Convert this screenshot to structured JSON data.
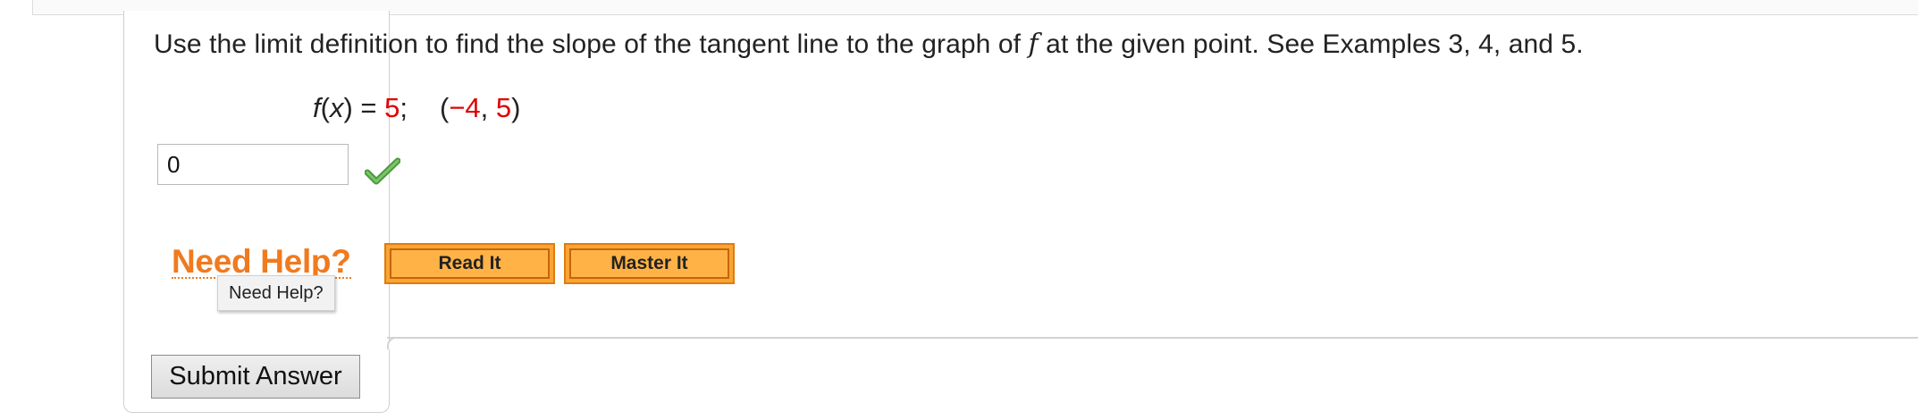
{
  "question": {
    "prefix": "Use the limit definition to find the slope of the tangent line to the graph of ",
    "func_name": "f",
    "suffix": " at the given point. See Examples 3, 4, and 5."
  },
  "formula": {
    "f": "f",
    "open_paren": "(",
    "x": "x",
    "close_eq": ") = ",
    "constant": "5",
    "semicolon": ";",
    "point_open": "(",
    "point_x": "−4",
    "comma": ", ",
    "point_y": "5",
    "point_close": ")",
    "highlight_color": "#e00000"
  },
  "answer": {
    "value": "0",
    "status_icon": "checkmark-icon",
    "status": "correct"
  },
  "help": {
    "heading": "Need Help?",
    "tooltip": "Need Help?",
    "read_it": "Read It",
    "master_it": "Master It",
    "accent_color": "#f07a1e"
  },
  "submit": {
    "label": "Submit Answer"
  }
}
